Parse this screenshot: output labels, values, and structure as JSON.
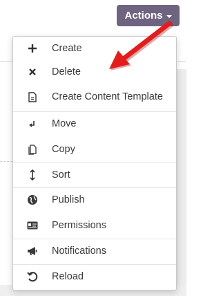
{
  "header": {
    "actions_label": "Actions"
  },
  "menu": {
    "items": [
      {
        "label": "Create",
        "icon": "plus-icon"
      },
      {
        "label": "Delete",
        "icon": "close-icon"
      },
      {
        "label": "Create Content Template",
        "icon": "document-icon"
      },
      {
        "label": "Move",
        "icon": "move-icon"
      },
      {
        "label": "Copy",
        "icon": "copy-icon"
      },
      {
        "label": "Sort",
        "icon": "sort-icon"
      },
      {
        "label": "Publish",
        "icon": "globe-icon"
      },
      {
        "label": "Permissions",
        "icon": "id-card-icon"
      },
      {
        "label": "Notifications",
        "icon": "megaphone-icon"
      },
      {
        "label": "Reload",
        "icon": "reload-icon"
      }
    ]
  },
  "colors": {
    "actions_button": "#6f6480",
    "arrow": "#e31c1c"
  }
}
